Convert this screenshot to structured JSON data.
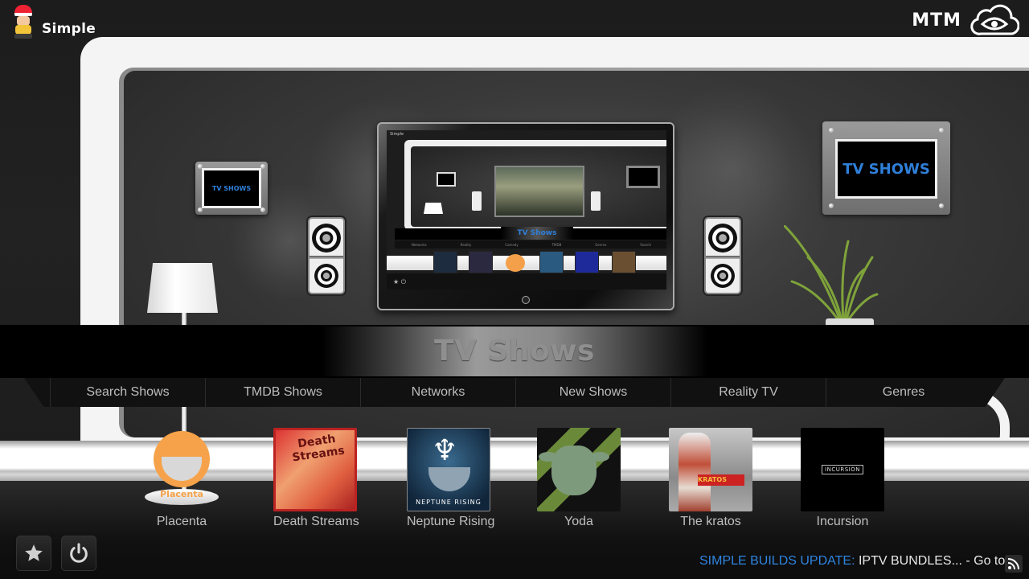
{
  "header": {
    "logo_text": "Simple",
    "brand_text": "MTM",
    "brand_icon": "cloud-eye-icon"
  },
  "decor": {
    "left_frame_text": "TV SHOWS",
    "right_frame_text": "TV SHOWS",
    "preview_title": "TV Shows",
    "preview_logo_text": "Simple",
    "preview_menu": [
      "Networks",
      "Reality",
      "Comedy",
      "TMDB",
      "Genres",
      "Search"
    ]
  },
  "section": {
    "title": "TV Shows"
  },
  "menu": {
    "items": [
      {
        "label": "Search Shows"
      },
      {
        "label": "TMDB Shows"
      },
      {
        "label": "Networks"
      },
      {
        "label": "New Shows"
      },
      {
        "label": "Reality TV"
      },
      {
        "label": "Genres"
      }
    ]
  },
  "addons": [
    {
      "label": "Placenta",
      "art_text": "Placenta"
    },
    {
      "label": "Death Streams",
      "art_text": "Death Streams"
    },
    {
      "label": "Neptune Rising",
      "art_text": "NEPTUNE RISING"
    },
    {
      "label": "Yoda",
      "art_text": ""
    },
    {
      "label": "The kratos",
      "art_text": "KRATOS"
    },
    {
      "label": "Incursion",
      "art_text": "INCURSION"
    }
  ],
  "controls": {
    "favourites_icon": "star-icon",
    "power_icon": "power-icon"
  },
  "ticker": {
    "highlight": "SIMPLE BUILDS UPDATE:",
    "text": " IPTV BUNDLES... - Go to",
    "icon": "rss-icon"
  },
  "colors": {
    "accent_blue": "#2f84e0",
    "menu_text": "#bdbdbd",
    "title_text": "#8f8f8f"
  }
}
